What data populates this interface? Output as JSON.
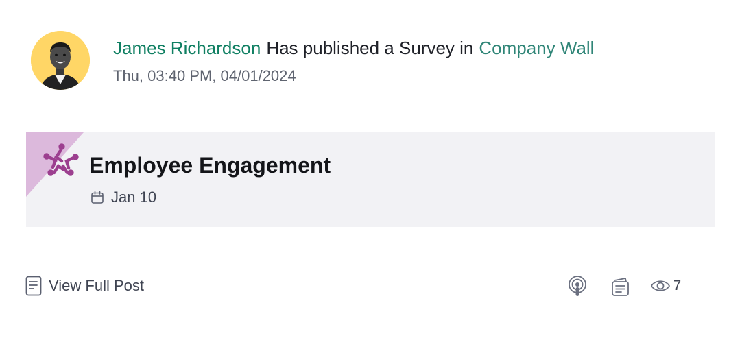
{
  "post": {
    "author": "James Richardson",
    "action_text": "Has published a Survey in",
    "location": "Company Wall",
    "timestamp": "Thu, 03:40 PM, 04/01/2024"
  },
  "survey": {
    "title": "Employee Engagement",
    "date": "Jan 10",
    "accent_color": "#9c3f8f",
    "corner_color": "#dcb9dc"
  },
  "footer": {
    "view_full_post_label": "View Full Post",
    "view_count": "7",
    "icons": [
      "document-icon",
      "podcast-icon",
      "notes-icon",
      "eye-icon"
    ]
  },
  "colors": {
    "author_link": "#0f7f62",
    "location_link": "#2f8577",
    "card_background": "#f2f2f5",
    "avatar_background": "#ffd666"
  }
}
